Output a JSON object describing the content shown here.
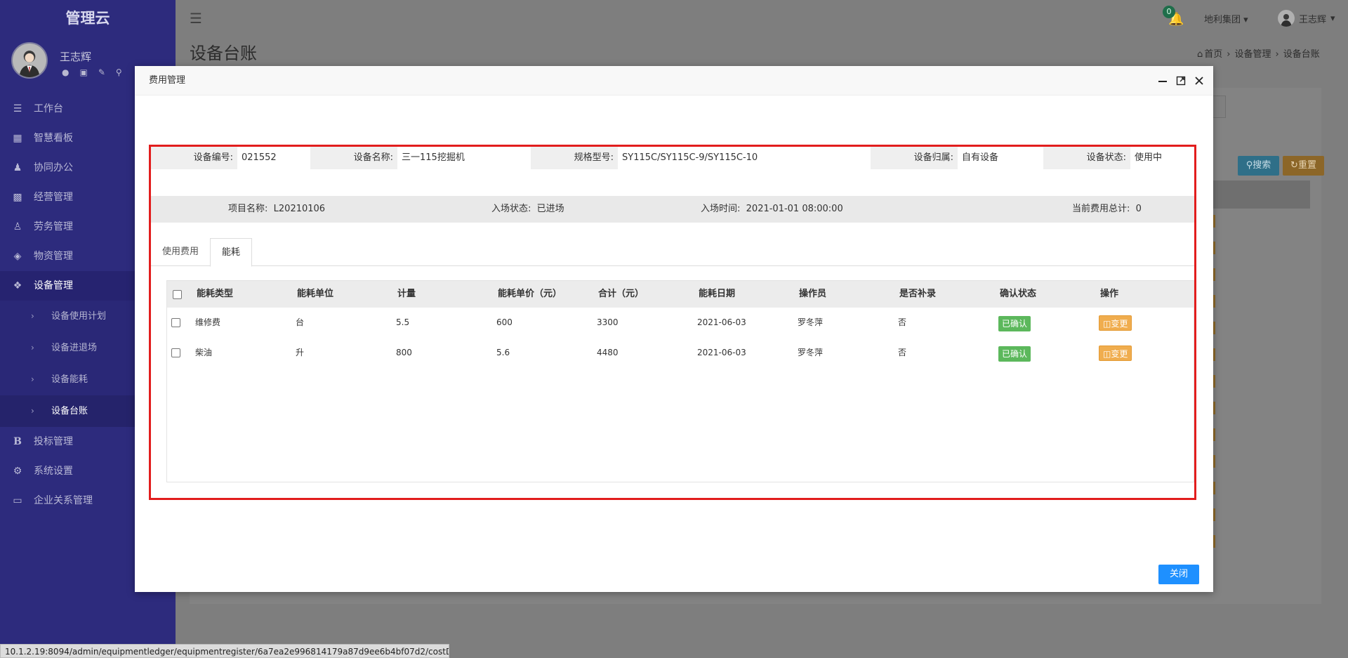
{
  "sidebar": {
    "brand": "管理云",
    "user_name": "王志辉",
    "menu": [
      {
        "label": "工作台",
        "icon": "dashboard-icon"
      },
      {
        "label": "智慧看板",
        "icon": "monitor-board-icon"
      },
      {
        "label": "协同办公",
        "icon": "users-icon"
      },
      {
        "label": "经营管理",
        "icon": "bar-chart-icon"
      },
      {
        "label": "劳务管理",
        "icon": "worker-icon"
      },
      {
        "label": "物资管理",
        "icon": "cube-icon"
      },
      {
        "label": "设备管理",
        "icon": "cubes-icon"
      }
    ],
    "submenu": [
      {
        "label": "设备使用计划"
      },
      {
        "label": "设备进退场"
      },
      {
        "label": "设备能耗"
      },
      {
        "label": "设备台账"
      }
    ],
    "menu_after": [
      {
        "label": "投标管理",
        "icon": "bold-b-icon"
      },
      {
        "label": "系统设置",
        "icon": "gear-icon"
      },
      {
        "label": "企业关系管理",
        "icon": "desktop-icon"
      }
    ]
  },
  "header": {
    "notification_count": "0",
    "org": "地利集团",
    "user": "王志辉"
  },
  "page": {
    "title": "设备台账",
    "breadcrumb": [
      "首页",
      "设备管理",
      "设备台账"
    ],
    "search_button": "搜索",
    "reset_button": "重置"
  },
  "modal": {
    "title": "费用管理",
    "equipment": {
      "code_label": "设备编号:",
      "code": "021552",
      "name_label": "设备名称:",
      "name": "三一115挖掘机",
      "model_label": "规格型号:",
      "model": "SY115C/SY115C-9/SY115C-10",
      "owner_label": "设备归属:",
      "owner": "自有设备",
      "status_label": "设备状态:",
      "status": "使用中"
    },
    "project": {
      "name_label": "项目名称:",
      "name": "L20210106",
      "entry_status_label": "入场状态:",
      "entry_status": "已进场",
      "entry_time_label": "入场时间:",
      "entry_time": "2021-01-01 08:00:00",
      "total_label": "当前费用总计:",
      "total": "0"
    },
    "tabs": [
      "使用费用",
      "能耗"
    ],
    "active_tab": "能耗",
    "table": {
      "headers": [
        "能耗类型",
        "能耗单位",
        "计量",
        "能耗单价（元）",
        "合计（元）",
        "能耗日期",
        "操作员",
        "是否补录",
        "确认状态",
        "操作"
      ],
      "rows": [
        {
          "type": "维修费",
          "unit": "台",
          "qty": "5.5",
          "price": "600",
          "total": "3300",
          "date": "2021-06-03",
          "operator": "罗冬萍",
          "supplement": "否",
          "status": "已确认",
          "action": "变更"
        },
        {
          "type": "柴油",
          "unit": "升",
          "qty": "800",
          "price": "5.6",
          "total": "4480",
          "date": "2021-06-03",
          "operator": "罗冬萍",
          "supplement": "否",
          "status": "已确认",
          "action": "变更"
        }
      ]
    },
    "close_button": "关闭"
  },
  "status_url": "10.1.2.19:8094/admin/equipmentledger/equipmentregister/6a7ea2e996814179a87d9ee6b4bf07d2/costDet...",
  "colors": {
    "sidebar": "#2d2b7d",
    "confirm_tag": "#5cb85c",
    "change_button": "#f0ad4e",
    "close_button": "#1e90ff",
    "frame": "#e21d1d"
  }
}
